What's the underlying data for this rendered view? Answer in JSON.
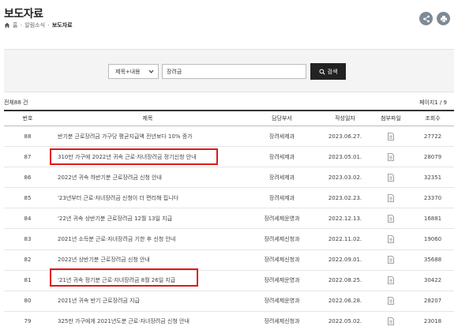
{
  "header": {
    "title": "보도자료",
    "breadcrumb": [
      "홈",
      "알림소식",
      "보도자료"
    ]
  },
  "search": {
    "select_value": "제목+내용",
    "query": "장려금",
    "button_label": "검색"
  },
  "summary": {
    "total": "전체88 건",
    "page": "페이지1 / 9"
  },
  "table": {
    "headers": [
      "번호",
      "제목",
      "담당부서",
      "작성일자",
      "첨부파일",
      "조회수"
    ],
    "rows": [
      {
        "no": "88",
        "title": "반기분 근로장려금 가구당 평균지급액 전년보다 10% 증가",
        "dept": "장려세제과",
        "date": "2023.06.27.",
        "views": "27722"
      },
      {
        "no": "87",
        "title": "310만 가구에 2022년 귀속 근로·자녀장려금 정기신청 안내",
        "dept": "장려세제과",
        "date": "2023.05.01.",
        "views": "28079"
      },
      {
        "no": "86",
        "title": "2022년 귀속 하반기분 근로장려금 신청 안내",
        "dept": "장려세제과",
        "date": "2023.03.02.",
        "views": "32351"
      },
      {
        "no": "85",
        "title": "'23년부터 근로·자녀장려금 신청이 더 편리해 집니다",
        "dept": "장려세제과",
        "date": "2023.02.23.",
        "views": "23370"
      },
      {
        "no": "84",
        "title": "'22년 귀속 상반기분 근로장려금 12월 13일 지급",
        "dept": "장려세제운영과",
        "date": "2022.12.13.",
        "views": "16881"
      },
      {
        "no": "83",
        "title": "2021년 소득분 근로·자녀장려금 기한 후 신청 안내",
        "dept": "장려세제신청과",
        "date": "2022.11.02.",
        "views": "19060"
      },
      {
        "no": "82",
        "title": "2022년 상반기분 근로장려금 신청 안내",
        "dept": "장려세제신청과",
        "date": "2022.09.01.",
        "views": "35688"
      },
      {
        "no": "81",
        "title": "'21년 귀속 정기분 근로·자녀장려금 8월 26일 지급",
        "dept": "장려세제운영과",
        "date": "2022.08.25.",
        "views": "30422"
      },
      {
        "no": "80",
        "title": "2021년 귀속 반기 근로장려금 지급",
        "dept": "장려세제운영과",
        "date": "2022.06.28.",
        "views": "28207"
      },
      {
        "no": "79",
        "title": "325만 가구에게 2021년도분 근로·자녀장려금 신청 안내",
        "dept": "장려세제신청과",
        "date": "2022.05.02.",
        "views": "23018"
      }
    ]
  },
  "colors": {
    "highlight": "#e01818",
    "search_button": "#222222",
    "round_button": "#7e8a94"
  },
  "icons": [
    "home-icon",
    "share-icon",
    "print-icon",
    "chevron-down-icon",
    "search-icon",
    "file-icon"
  ]
}
